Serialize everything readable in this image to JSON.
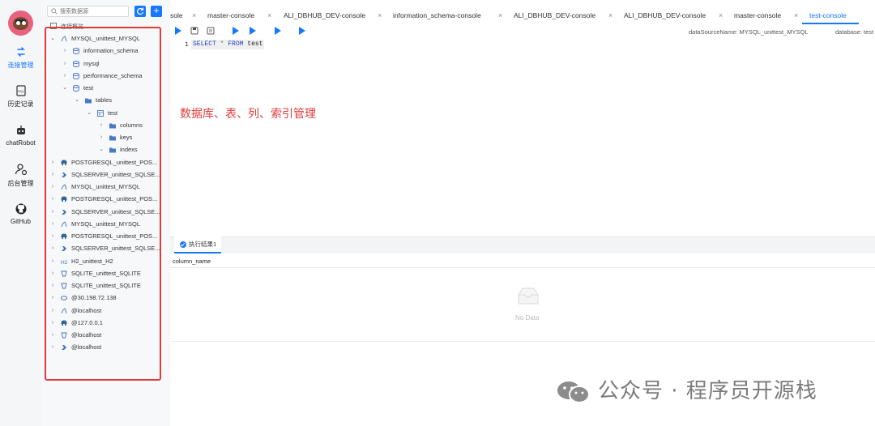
{
  "rail": {
    "items": [
      {
        "label": "连接管理",
        "icon": "connection-icon",
        "active": true
      },
      {
        "label": "历史记录",
        "icon": "sql-history-icon",
        "active": false
      },
      {
        "label": "chatRobot",
        "icon": "robot-icon",
        "active": false
      },
      {
        "label": "后台管理",
        "icon": "user-admin-icon",
        "active": false
      },
      {
        "label": "GitHub",
        "icon": "github-icon",
        "active": false
      }
    ]
  },
  "sidebar": {
    "search_placeholder": "搜索数据源",
    "overview_label": "连接概览",
    "tree": [
      {
        "label": "MYSQL_unittest_MYSQL",
        "icon": "mysql-icon",
        "level": 0,
        "expanded": true
      },
      {
        "label": "information_schema",
        "icon": "database-icon",
        "level": 1,
        "expanded": false
      },
      {
        "label": "mysql",
        "icon": "database-icon",
        "level": 1,
        "expanded": false
      },
      {
        "label": "performance_schema",
        "icon": "database-icon",
        "level": 1,
        "expanded": false
      },
      {
        "label": "test",
        "icon": "database-icon",
        "level": 1,
        "expanded": true
      },
      {
        "label": "tables",
        "icon": "folder-icon",
        "level": 2,
        "expanded": true
      },
      {
        "label": "test",
        "icon": "table-icon",
        "level": 3,
        "expanded": true
      },
      {
        "label": "columns",
        "icon": "folder-icon",
        "level": 4,
        "expanded": false
      },
      {
        "label": "keys",
        "icon": "folder-icon",
        "level": 4,
        "expanded": false
      },
      {
        "label": "indexs",
        "icon": "folder-icon",
        "level": 4,
        "expanded": true
      },
      {
        "label": "POSTGRESQL_unittest_POS...",
        "icon": "postgresql-icon",
        "level": 0,
        "expanded": false
      },
      {
        "label": "SQLSERVER_unittest_SQLSE...",
        "icon": "sqlserver-icon",
        "level": 0,
        "expanded": false
      },
      {
        "label": "MYSQL_unittest_MYSQL",
        "icon": "mysql-icon",
        "level": 0,
        "expanded": false
      },
      {
        "label": "POSTGRESQL_unittest_POS...",
        "icon": "postgresql-icon",
        "level": 0,
        "expanded": false
      },
      {
        "label": "SQLSERVER_unittest_SQLSE...",
        "icon": "sqlserver-icon",
        "level": 0,
        "expanded": false
      },
      {
        "label": "MYSQL_unittest_MYSQL",
        "icon": "mysql-icon",
        "level": 0,
        "expanded": false
      },
      {
        "label": "POSTGRESQL_unittest_POS...",
        "icon": "postgresql-icon",
        "level": 0,
        "expanded": false
      },
      {
        "label": "SQLSERVER_unittest_SQLSE...",
        "icon": "sqlserver-icon",
        "level": 0,
        "expanded": false
      },
      {
        "label": "H2_unittest_H2",
        "icon": "h2-icon",
        "level": 0,
        "expanded": false
      },
      {
        "label": "SQLITE_unittest_SQLITE",
        "icon": "sqlite-icon",
        "level": 0,
        "expanded": false
      },
      {
        "label": "SQLITE_unittest_SQLITE",
        "icon": "sqlite-icon",
        "level": 0,
        "expanded": false
      },
      {
        "label": "@30.198.72.138",
        "icon": "oracle-icon",
        "level": 0,
        "expanded": false
      },
      {
        "label": "@localhost",
        "icon": "mysql-icon",
        "level": 0,
        "expanded": false
      },
      {
        "label": "@127.0.0.1",
        "icon": "postgresql-icon",
        "level": 0,
        "expanded": false
      },
      {
        "label": "@localhost",
        "icon": "sqlite-icon",
        "level": 0,
        "expanded": false
      },
      {
        "label": "@localhost",
        "icon": "sqlserver-icon",
        "level": 0,
        "expanded": false
      }
    ]
  },
  "tabs": [
    {
      "label": "sole",
      "active": false
    },
    {
      "label": "master-console",
      "active": false
    },
    {
      "label": "ALI_DBHUB_DEV-console",
      "active": false
    },
    {
      "label": "information_schema-console",
      "active": false
    },
    {
      "label": "ALI_DBHUB_DEV-console",
      "active": false
    },
    {
      "label": "ALI_DBHUB_DEV-console",
      "active": false
    },
    {
      "label": "master-console",
      "active": false
    },
    {
      "label": "test-console",
      "active": true
    }
  ],
  "status": {
    "datasource": "dataSourceName: MYSQL_unittest_MYSQL",
    "database": "database: test"
  },
  "editor": {
    "line_number": "1",
    "sql": {
      "kw1": "SELECT",
      "star": "*",
      "kw2": "FROM",
      "table": "test"
    }
  },
  "annotation": "数据库、表、列、索引管理",
  "results": {
    "tab_label": "执行结果1",
    "column_header": "column_name",
    "empty_text": "No Data"
  },
  "watermark": "公众号 · 程序员开源栈",
  "colors": {
    "accent": "#1677ff",
    "highlight_red": "#e23b3b"
  }
}
